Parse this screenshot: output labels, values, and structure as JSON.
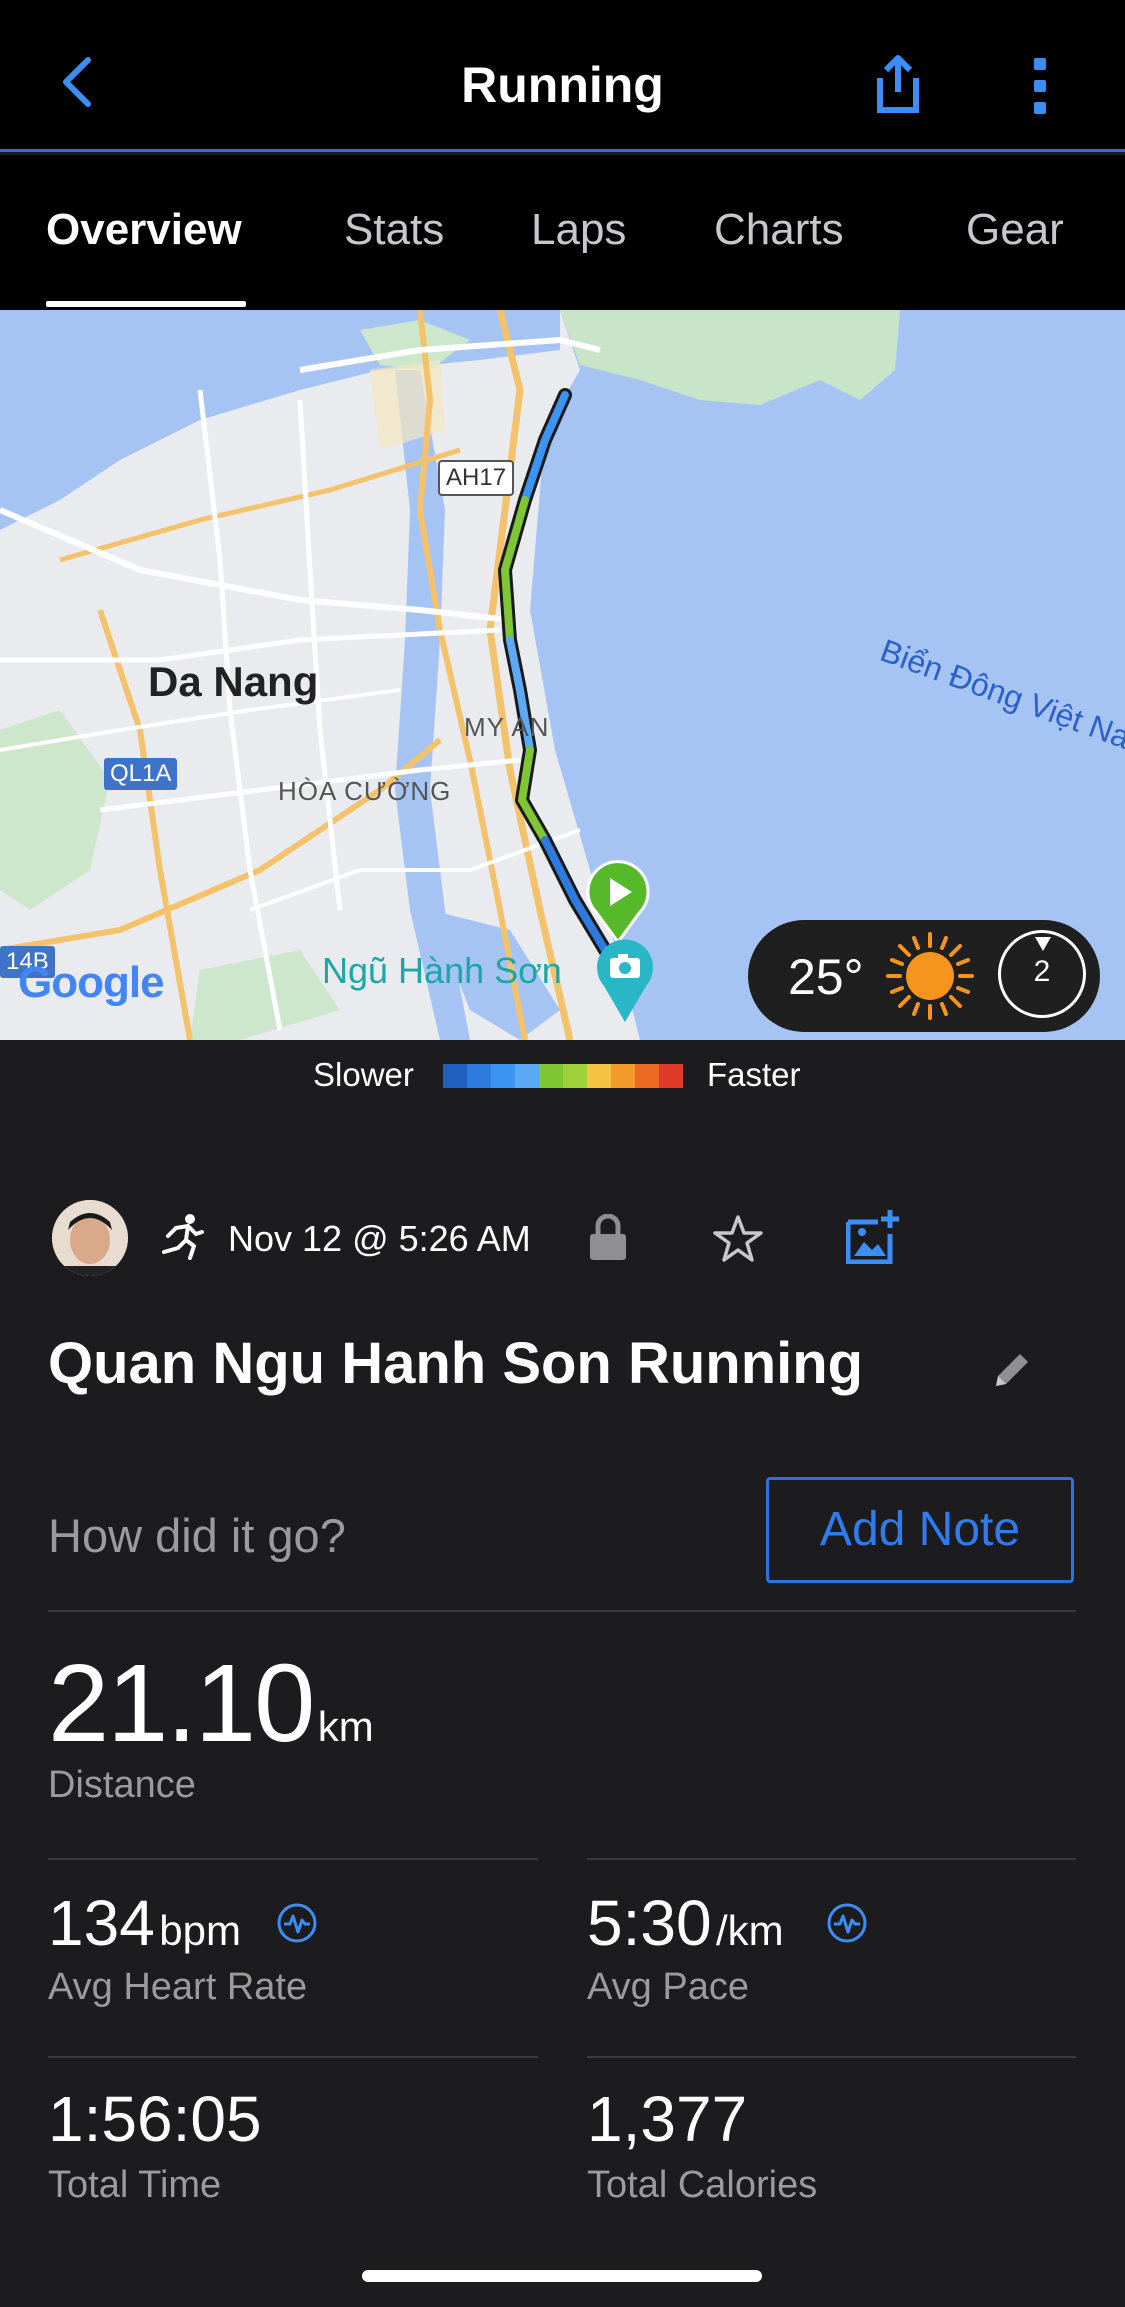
{
  "header": {
    "title": "Running",
    "back_icon": "chevron-left-icon",
    "share_icon": "share-icon",
    "more_icon": "more-vertical-icon",
    "accent_color": "#3a8ef6"
  },
  "tabs": [
    {
      "label": "Overview",
      "active": true
    },
    {
      "label": "Stats",
      "active": false
    },
    {
      "label": "Laps",
      "active": false
    },
    {
      "label": "Charts",
      "active": false
    },
    {
      "label": "Gear",
      "active": false
    }
  ],
  "map": {
    "labels": {
      "city": "Da Nang",
      "sea": "Biển Đông Việt Na",
      "road1": "AH17",
      "road2": "QL1A",
      "road3": "14B",
      "district1": "MY AN",
      "district2": "HÒA CƯỜNG",
      "district3": "Ngũ Hành Sơn",
      "google": "Google"
    },
    "weather": {
      "temperature": "25°",
      "icon": "sun-icon",
      "wind": "2"
    }
  },
  "legend": {
    "slower": "Slower",
    "faster": "Faster",
    "colors": [
      "#1f5fbf",
      "#2e7be0",
      "#3b95f0",
      "#5aaaf5",
      "#7ec634",
      "#9fd23a",
      "#f5c242",
      "#f39a2b",
      "#ee6a22",
      "#e03a2a"
    ]
  },
  "activity": {
    "date": "Nov 12 @ 5:26 AM",
    "name": "Quan Ngu Hanh Son Running",
    "note_prompt": "How did it go?",
    "add_note": "Add Note"
  },
  "stats": {
    "distance": {
      "value": "21.10",
      "unit": "km",
      "label": "Distance"
    },
    "heart_rate": {
      "value": "134",
      "unit": "bpm",
      "label": "Avg Heart Rate"
    },
    "pace": {
      "value": "5:30",
      "unit": "/km",
      "label": "Avg Pace"
    },
    "time": {
      "value": "1:56:05",
      "label": "Total Time"
    },
    "calories": {
      "value": "1,377",
      "label": "Total Calories"
    }
  }
}
